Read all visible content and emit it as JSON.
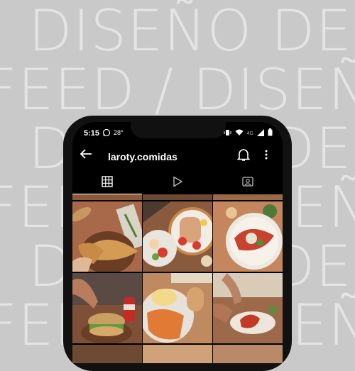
{
  "background": {
    "lines": [
      "DISEÑO DE",
      "FEED / DISEÑO",
      "DISEÑO DE",
      "FEED / DISEÑO",
      "DISEÑO DE",
      "FEED / DISEÑO"
    ]
  },
  "status_bar": {
    "time": "5:15",
    "temp": "28°",
    "network": "4G"
  },
  "profile": {
    "username": "laroty.comidas"
  },
  "icons": {
    "back": "arrow-left-icon",
    "bell": "bell-icon",
    "more": "more-vertical-icon",
    "grid": "grid-icon",
    "reels": "play-icon",
    "tagged": "tagged-person-icon"
  },
  "colors": {
    "background": "#c9c9c9",
    "bg_text": "#e4e4e4",
    "screen": "#000000",
    "text": "#ffffff"
  },
  "grid_items": [
    {
      "label": "Empanadas en tabla"
    },
    {
      "label": "Matambre con vegetales"
    },
    {
      "label": "Plato con salsa y queso"
    },
    {
      "label": "Sándwich con bebida"
    },
    {
      "label": "Milanesa con puré"
    },
    {
      "label": "Plato con salsa"
    }
  ]
}
